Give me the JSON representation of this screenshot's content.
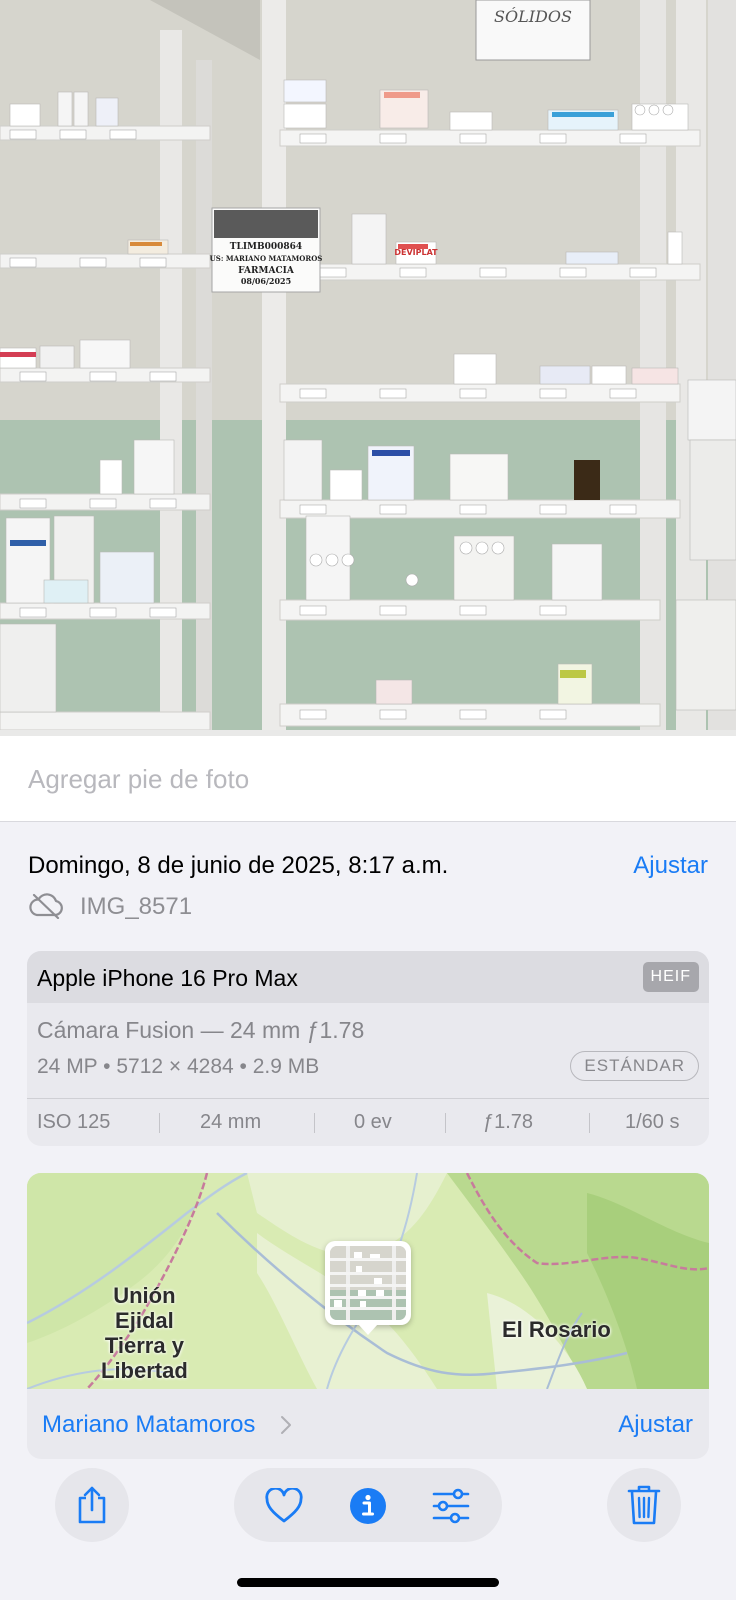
{
  "photo": {
    "shelf_sign": "SÓLIDOS",
    "paper_note": [
      "TLIMB000864",
      "US: MARIANO MATAMOROS",
      "FARMACIA",
      "08/06/2025"
    ],
    "box_labels": [
      "DEVIPLAT",
      "Puritos 500"
    ]
  },
  "caption": {
    "placeholder": "Agregar pie de foto",
    "value": ""
  },
  "info": {
    "date": "Domingo, 8 de junio de 2025, 8:17 a.m.",
    "adjust_label": "Ajustar",
    "file_name": "IMG_8571",
    "cloud_icon": "cloud-slash-icon"
  },
  "camera": {
    "device": "Apple iPhone 16 Pro Max",
    "format_badge": "HEIF",
    "lens": "Cámara Fusion — 24 mm ƒ1.78",
    "specs": "24 MP • 5712 × 4284 • 2.9 MB",
    "style_badge": "ESTÁNDAR",
    "exif": [
      "ISO 125",
      "24 mm",
      "0 ev",
      "ƒ1.78",
      "1/60 s"
    ]
  },
  "map": {
    "labels": {
      "west": "Unión\nEjidal\nTierra y\nLibertad",
      "east": "El Rosario"
    },
    "location_name": "Mariano Matamoros",
    "adjust_label": "Ajustar"
  },
  "toolbar": {
    "icons": [
      "share-icon",
      "heart-icon",
      "info-icon",
      "adjust-sliders-icon",
      "trash-icon"
    ],
    "accent": "#1a7cf5"
  }
}
